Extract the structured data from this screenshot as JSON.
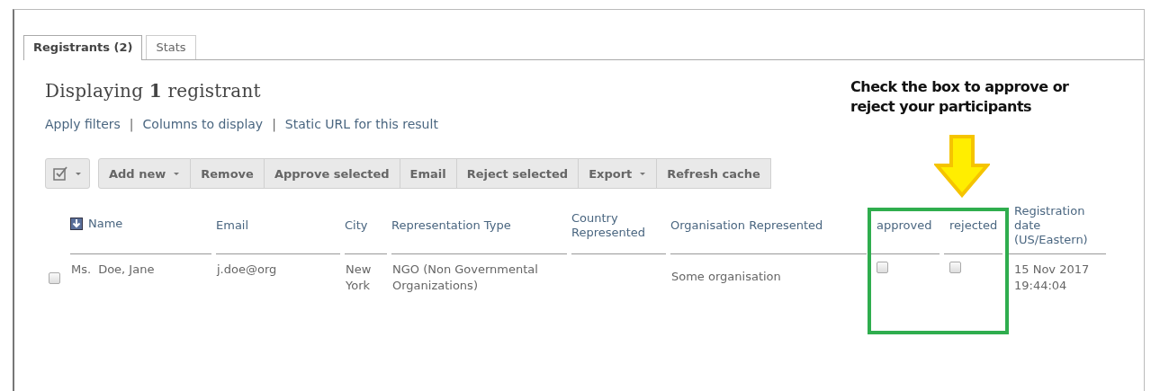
{
  "tabs": [
    {
      "label": "Registrants (2)",
      "selected": true
    },
    {
      "label": "Stats",
      "selected": false
    }
  ],
  "heading": {
    "before": "Displaying ",
    "count": "1",
    "after": " registrant"
  },
  "links": [
    "Apply filters",
    "|",
    "Columns to display",
    "|",
    "Static URL for this result"
  ],
  "toolbar": {
    "select_menu": {
      "checked": true
    },
    "buttons": [
      {
        "label": "Add new",
        "dropdown": true
      },
      {
        "label": "Remove",
        "dropdown": false
      },
      {
        "label": "Approve selected",
        "dropdown": false
      },
      {
        "label": "Email",
        "dropdown": false
      },
      {
        "label": "Reject selected",
        "dropdown": false
      },
      {
        "label": "Export",
        "dropdown": true
      },
      {
        "label": "Refresh cache",
        "dropdown": false
      }
    ]
  },
  "table": {
    "columns": [
      {
        "label": "Name",
        "sorted": true
      },
      {
        "label": "Email",
        "sorted": false
      },
      {
        "label": "City",
        "sorted": false
      },
      {
        "label": "Representation Type",
        "sorted": false
      },
      {
        "label": "Country Represented",
        "sorted": false
      },
      {
        "label": "Organisation Represented",
        "sorted": false
      },
      {
        "label": "approved",
        "sorted": false
      },
      {
        "label": "rejected",
        "sorted": false
      },
      {
        "label": "Registration date (US/Eastern)",
        "sorted": false
      }
    ],
    "rows": [
      {
        "selected": false,
        "title": "Ms.",
        "name": "Doe, Jane",
        "email": "j.doe@org",
        "city": "New York",
        "representation_type": "NGO (Non Governmental Organizations)",
        "organisation": "Some organisation",
        "approved": false,
        "rejected": false,
        "registration_date": "15 Nov 2017 19:44:04"
      }
    ]
  },
  "annotation": {
    "text": "Check the box to approve or reject your participants"
  }
}
